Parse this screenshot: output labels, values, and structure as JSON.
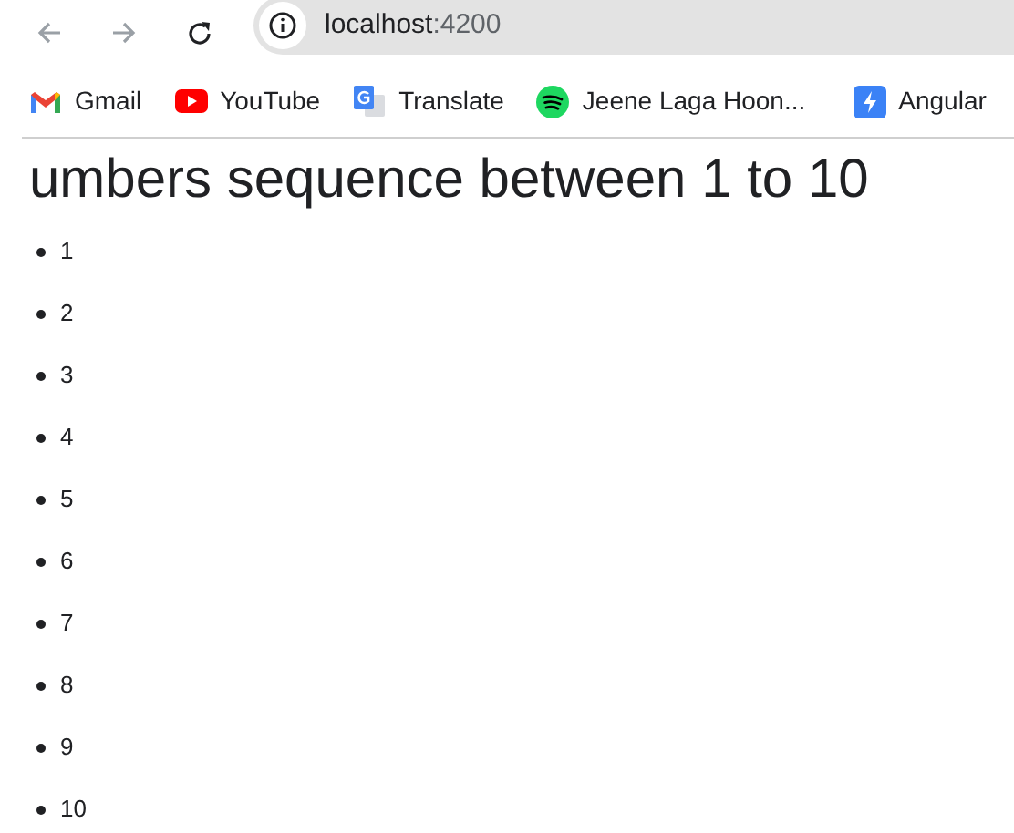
{
  "address_bar": {
    "host": "localhost",
    "port": ":4200"
  },
  "bookmarks": [
    {
      "kind": "gmail",
      "label": "Gmail"
    },
    {
      "kind": "youtube",
      "label": "YouTube"
    },
    {
      "kind": "translate",
      "label": "Translate"
    },
    {
      "kind": "spotify",
      "label": "Jeene Laga Hoon..."
    },
    {
      "kind": "angular",
      "label": "Angular"
    }
  ],
  "heading": "umbers sequence between 1 to 10",
  "list": [
    "1",
    "2",
    "3",
    "4",
    "5",
    "6",
    "7",
    "8",
    "9",
    "10"
  ]
}
